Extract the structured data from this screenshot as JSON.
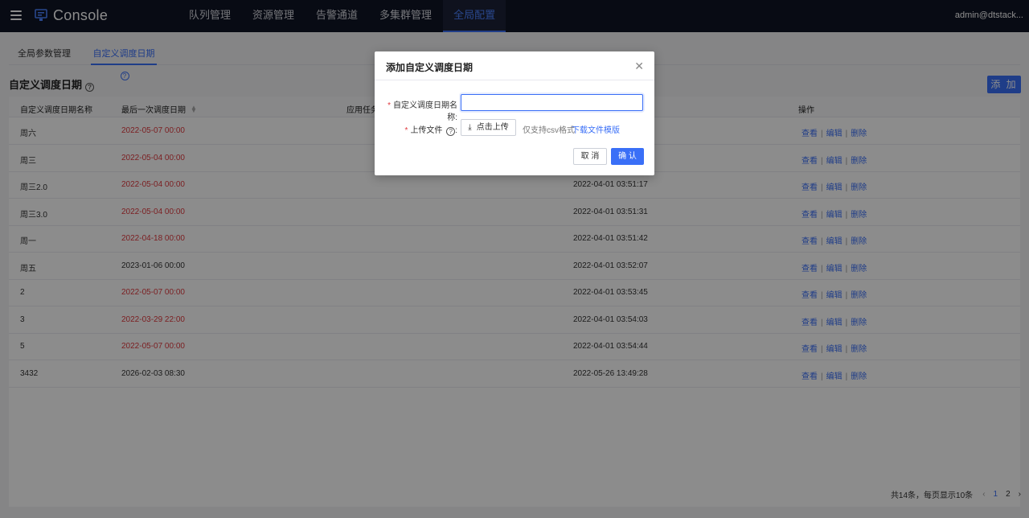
{
  "app": {
    "title": "Console",
    "user": "admin@dtstack..."
  },
  "nav": [
    "队列管理",
    "资源管理",
    "告警通道",
    "多集群管理",
    "全局配置"
  ],
  "subtabs": {
    "params": "全局参数管理",
    "custom_dates": "自定义调度日期"
  },
  "section_title": "自定义调度日期",
  "add_label": "添 加",
  "table": {
    "headers": {
      "name": "自定义调度日期名称",
      "last_date": "最后一次调度日期",
      "tasks": "应用任务",
      "ops": "操作"
    },
    "rows": [
      {
        "name": "周六",
        "last_date": "2022-05-07 00:00",
        "created": "",
        "overdue": true
      },
      {
        "name": "周三",
        "last_date": "2022-05-04 00:00",
        "created": "",
        "overdue": true
      },
      {
        "name": "周三2.0",
        "last_date": "2022-05-04 00:00",
        "created": "2022-04-01 03:51:17",
        "overdue": true
      },
      {
        "name": "周三3.0",
        "last_date": "2022-05-04 00:00",
        "created": "2022-04-01 03:51:31",
        "overdue": true
      },
      {
        "name": "周一",
        "last_date": "2022-04-18 00:00",
        "created": "2022-04-01 03:51:42",
        "overdue": true
      },
      {
        "name": "周五",
        "last_date": "2023-01-06 00:00",
        "created": "2022-04-01 03:52:07",
        "overdue": false
      },
      {
        "name": "2",
        "last_date": "2022-05-07 00:00",
        "created": "2022-04-01 03:53:45",
        "overdue": true
      },
      {
        "name": "3",
        "last_date": "2022-03-29 22:00",
        "created": "2022-04-01 03:54:03",
        "overdue": true
      },
      {
        "name": "5",
        "last_date": "2022-05-07 00:00",
        "created": "2022-04-01 03:54:44",
        "overdue": true
      },
      {
        "name": "3432",
        "last_date": "2026-02-03 08:30",
        "created": "2022-05-26 13:49:28",
        "overdue": false
      }
    ],
    "ops": {
      "view": "查看",
      "edit": "编辑",
      "delete": "删除"
    }
  },
  "pager": {
    "summary": "共14条，每页显示10条",
    "pages": [
      "1",
      "2"
    ],
    "current": "1"
  },
  "modal": {
    "title": "添加自定义调度日期",
    "name_label": "自定义调度日期名称:",
    "name_value": "",
    "file_label": "上传文件",
    "file_label_suffix": ":",
    "upload_label": "点击上传",
    "upload_hint": "仅支持csv格式",
    "template_link": "下载文件模版",
    "cancel": "取 消",
    "ok": "确 认"
  },
  "colors": {
    "accent": "#3a6ff7",
    "overdue": "#e0393e",
    "topbar": "#101425"
  },
  "icons": [
    "menu-icon",
    "console-logo-icon",
    "help-icon",
    "sort-icon",
    "close-icon",
    "upload-icon",
    "chevron-left-icon",
    "chevron-right-icon"
  ]
}
